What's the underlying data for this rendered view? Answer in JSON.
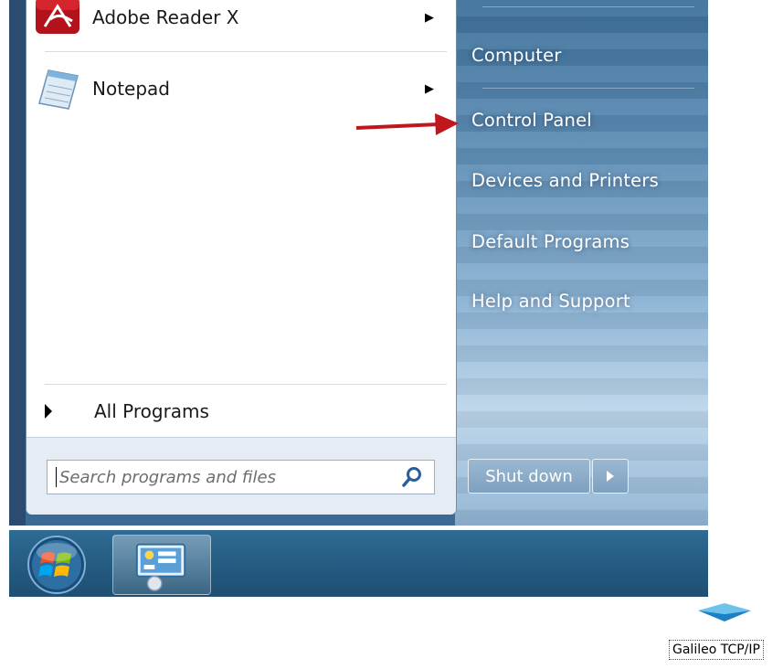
{
  "start_menu": {
    "programs": [
      {
        "label": "Adobe Reader X",
        "icon": "adobe-reader-icon",
        "has_submenu": true
      },
      {
        "label": "Notepad",
        "icon": "notepad-icon",
        "has_submenu": true
      }
    ],
    "all_programs_label": "All Programs",
    "search": {
      "placeholder": "Search programs and files",
      "icon": "search-icon"
    },
    "right_links": [
      "Computer",
      "Control Panel",
      "Devices and Printers",
      "Default Programs",
      "Help and Support"
    ],
    "shutdown_label": "Shut down"
  },
  "taskbar": {
    "start_orb_icon": "windows-orb-icon",
    "pinned_icon": "control-panel-icon"
  },
  "annotation": {
    "arrow_color": "#c0161d",
    "target": "Control Panel"
  },
  "desktop": {
    "shortcut_label": "Galileo TCP/IP",
    "shortcut_icon": "galileo-logo-icon"
  },
  "colors": {
    "taskbar": "#255c82",
    "right_pane": "#5f8fb6",
    "annotation_arrow": "#c0161d"
  }
}
